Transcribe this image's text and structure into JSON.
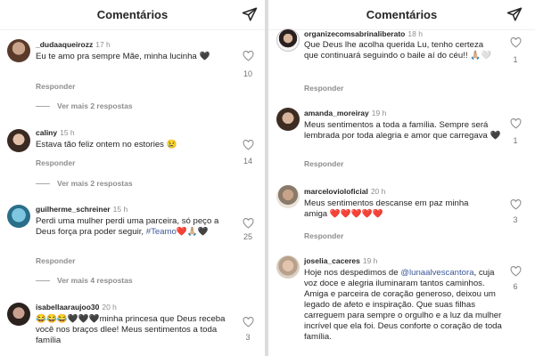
{
  "left": {
    "title": "Comentários",
    "comments": [
      {
        "user": "_dudaaqueirozz",
        "time": "17 h",
        "text": "Eu te amo pra sempre Mãe, minha lucinha 🖤",
        "reply": "Responder",
        "likes": "10",
        "more": "Ver mais 2 respostas"
      },
      {
        "user": "caliny",
        "time": "15 h",
        "text": "Estava tão feliz ontem no estories 😢",
        "reply": "Responder",
        "likes": "14",
        "more": "Ver mais 2 respostas"
      },
      {
        "user": "guilherme_schreiner",
        "time": "15 h",
        "text_before": "Perdi uma mulher perdi uma parceira, só peço a Deus força pra poder seguir, ",
        "hashtag": "#Teamo",
        "text_after": "❤️🙏🏼🖤",
        "reply": "Responder",
        "likes": "25",
        "more": "Ver mais 4 respostas"
      },
      {
        "user": "isabellaaraujoo30",
        "time": "20 h",
        "text": "😂😂😂🖤🖤🖤minha princesa que Deus receba você nos braços dlee! Meus sentimentos a toda família",
        "likes": "3"
      }
    ]
  },
  "right": {
    "title": "Comentários",
    "comments": [
      {
        "user": "organizecomsabrinaliberato",
        "time": "18 h",
        "text": "Que Deus lhe acolha querida Lu, tenho certeza que continuará seguindo o baile aí do céu!! 🙏🏼🤍",
        "reply": "Responder",
        "likes": "1"
      },
      {
        "user": "amanda_moreiray",
        "time": "19 h",
        "text": "Meus sentimentos a toda a família. Sempre será lembrada por toda alegria e amor que carregava 🖤",
        "reply": "Responder",
        "likes": "1"
      },
      {
        "user": "marcelovioloficial",
        "time": "20 h",
        "text": "Meus sentimentos descanse em paz minha amiga ❤️❤️❤️❤️❤️",
        "reply": "Responder",
        "likes": "3"
      },
      {
        "user": "joselia_caceres",
        "time": "19 h",
        "text_before": "Hoje nos despedimos de ",
        "mention": "@lunaalvescantora",
        "text_after": ", cuja voz doce e alegria iluminaram tantos caminhos. Amiga e parceira de coração generoso, deixou um legado de afeto e inspiração. Que suas filhas carreguem para sempre o orgulho e a luz da mulher incrível que ela foi. Deus conforte o coração de toda família.",
        "likes": "6"
      }
    ]
  },
  "colors": {
    "text": "#262626",
    "muted": "#8e8e8e",
    "link": "#3d5a99",
    "background": "#ffffff"
  },
  "icons": {
    "share": "paper-plane-icon",
    "like": "heart-outline-icon"
  }
}
